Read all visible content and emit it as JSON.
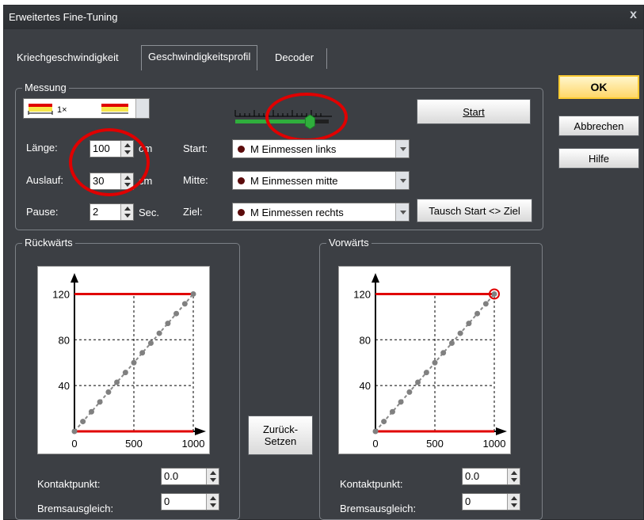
{
  "window": {
    "title": "Erweitertes Fine-Tuning",
    "close": "x"
  },
  "tabs": [
    "Kriechgeschwindigkeit",
    "Geschwindigkeitsprofil",
    "Decoder"
  ],
  "buttons": {
    "ok": "OK",
    "cancel": "Abbrechen",
    "help": "Hilfe",
    "start": "Start",
    "swap": "Tausch Start <> Ziel",
    "reset_line1": "Zurück-",
    "reset_line2": "Setzen"
  },
  "messung": {
    "label": "Messung",
    "measure_type": "1×",
    "length_label": "Länge:",
    "length_value": "100",
    "length_unit": "cm",
    "runout_label": "Auslauf:",
    "runout_value": "30",
    "runout_unit": "cm",
    "pause_label": "Pause:",
    "pause_value": "2",
    "pause_unit": "Sec.",
    "start_label": "Start:",
    "start_value": "M Einmessen links",
    "middle_label": "Mitte:",
    "middle_value": "M Einmessen mitte",
    "target_label": "Ziel:",
    "target_value": "M Einmessen rechts",
    "speed_slider_value": 0.8
  },
  "reverse": {
    "label": "Rückwärts",
    "contact_label": "Kontaktpunkt:",
    "contact_value": "0.0",
    "brake_label": "Bremsausgleich:",
    "brake_value": "0"
  },
  "forward": {
    "label": "Vorwärts",
    "contact_label": "Kontaktpunkt:",
    "contact_value": "0.0",
    "brake_label": "Bremsausgleich:",
    "brake_value": "0"
  },
  "colors": {
    "limit_line": "#e00000",
    "curve": "#8a8a8a",
    "highlight": "#e00000",
    "ok_accent": "#ffcc33"
  },
  "chart_data": [
    {
      "type": "line",
      "xlim": [
        0,
        1000
      ],
      "ylim": [
        0,
        130
      ],
      "xticks": [
        0,
        500,
        1000
      ],
      "yticks": [
        40,
        80,
        120
      ],
      "x": [
        0,
        71,
        143,
        214,
        286,
        357,
        429,
        500,
        571,
        643,
        714,
        786,
        857,
        929,
        1000
      ],
      "y": [
        0,
        8.6,
        17.1,
        25.7,
        34.3,
        42.9,
        51.4,
        60,
        68.6,
        77.1,
        85.7,
        94.3,
        102.9,
        111.4,
        120
      ],
      "limit_max": 120,
      "limit_min": 0
    },
    {
      "type": "line",
      "xlim": [
        0,
        1000
      ],
      "ylim": [
        0,
        130
      ],
      "xticks": [
        0,
        500,
        1000
      ],
      "yticks": [
        40,
        80,
        120
      ],
      "x": [
        0,
        71,
        143,
        214,
        286,
        357,
        429,
        500,
        571,
        643,
        714,
        786,
        857,
        929,
        1000
      ],
      "y": [
        0,
        8.6,
        17.1,
        25.7,
        34.3,
        42.9,
        51.4,
        60,
        68.6,
        77.1,
        85.7,
        94.3,
        102.9,
        111.4,
        120
      ],
      "limit_max": 120,
      "limit_min": 0,
      "highlight_point": [
        1000,
        120
      ]
    }
  ]
}
